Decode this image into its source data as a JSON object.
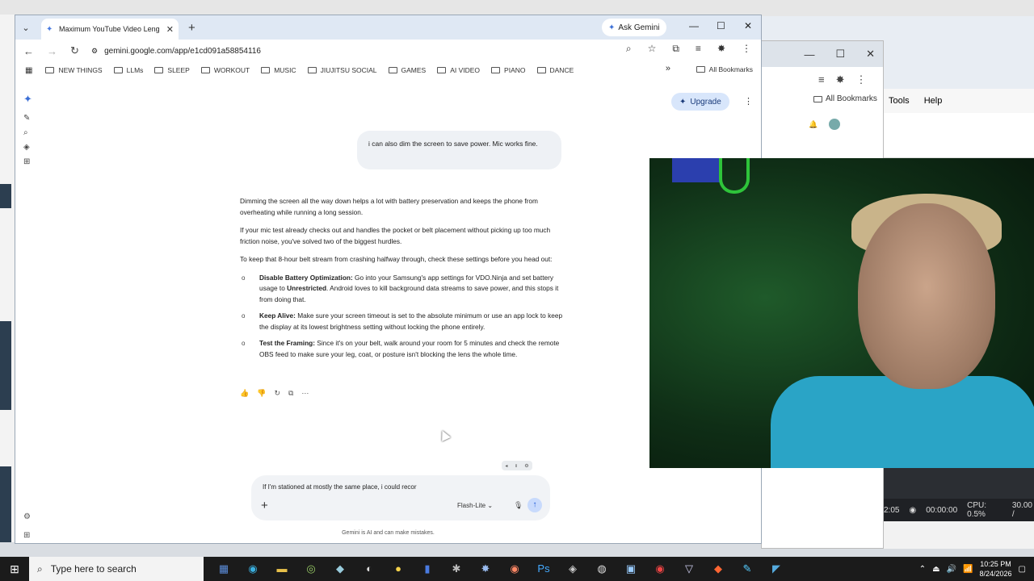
{
  "browser": {
    "tab_title": "Maximum YouTube Video Leng",
    "ask_gemini": "Ask Gemini",
    "url": "gemini.google.com/app/e1cd091a58854116",
    "bookmarks": [
      "NEW THINGS",
      "LLMs",
      "SLEEP",
      "WORKOUT",
      "MUSIC",
      "JIUJITSU SOCIAL",
      "GAMES",
      "AI VIDEO",
      "PIANO",
      "DANCE"
    ],
    "all_bookmarks": "All Bookmarks"
  },
  "gemini": {
    "upgrade": "Upgrade",
    "user_message": "i can also dim the screen to save power. Mic works fine.",
    "response": {
      "p1": "Dimming the screen all the way down helps a lot with battery preservation and keeps the phone from overheating while running a long session.",
      "p2": "If your mic test already checks out and handles the pocket or belt placement without picking up too much friction noise, you've solved two of the biggest hurdles.",
      "p3": "To keep that 8-hour belt stream from crashing halfway through, check these settings before you head out:",
      "items": [
        {
          "title": "Disable Battery Optimization:",
          "pre": " Go into your Samsung's app settings for VDO.Ninja and set battery usage to ",
          "bold2": "Unrestricted",
          "post": ". Android loves to kill background data streams to save power, and this stops it from doing that."
        },
        {
          "title": "Keep Alive:",
          "pre": " Make sure your screen timeout is set to the absolute minimum or use an app lock to keep the display at its lowest brightness setting without locking the phone entirely.",
          "bold2": "",
          "post": ""
        },
        {
          "title": "Test the Framing:",
          "pre": " Since it's on your belt, walk around your room for 5 minutes and check the remote OBS feed to make sure your leg, coat, or posture isn't blocking the lens the whole time.",
          "bold2": "",
          "post": ""
        }
      ]
    },
    "composer_text": "If I'm stationed at mostly the same place, i could recor",
    "model": "Flash-Lite",
    "disclaimer": "Gemini is AI and can make mistakes."
  },
  "background_app": {
    "all_bookmarks": "All Bookmarks",
    "menu": [
      "Tools",
      "Help"
    ]
  },
  "obs": {
    "time": "2:05",
    "rec": "00:00:00",
    "cpu": "CPU: 0.5%",
    "fps": "30.00 /"
  },
  "taskbar": {
    "search_placeholder": "Type here to search",
    "time": "10:25 PM",
    "date": "8/24/2026"
  }
}
